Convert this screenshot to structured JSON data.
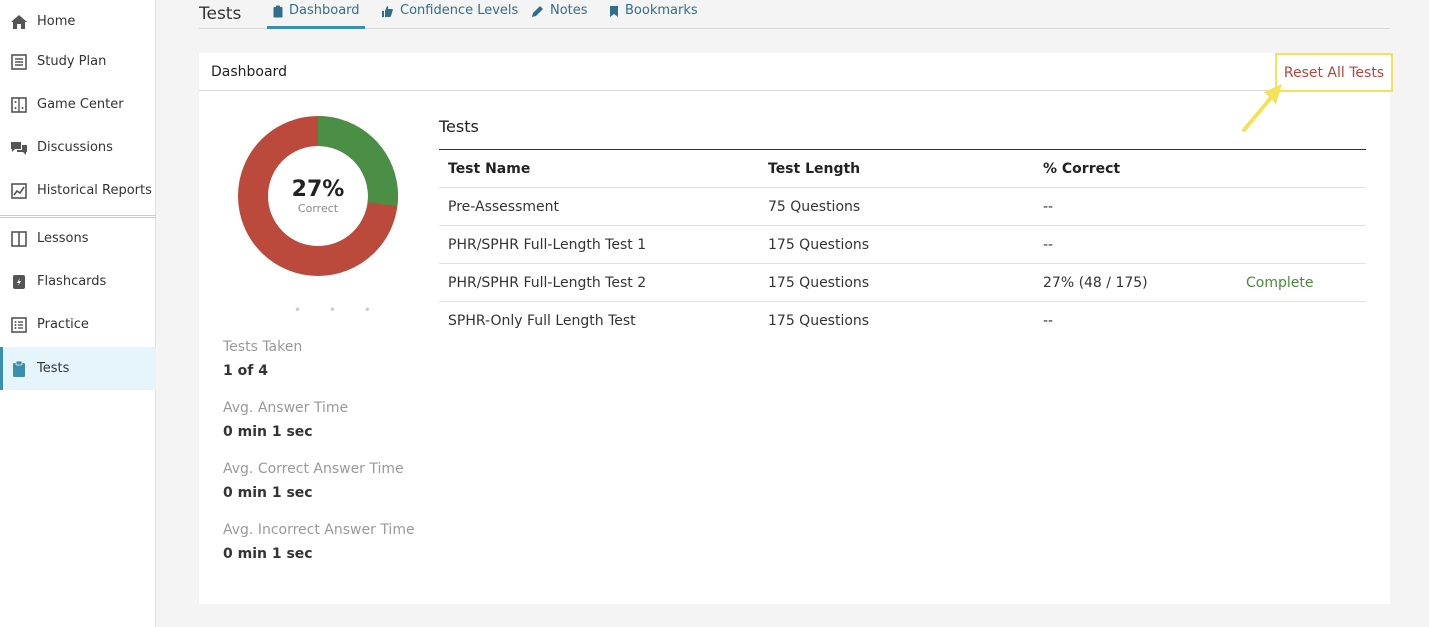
{
  "sidebar": {
    "items": [
      {
        "label": "Home",
        "icon": "home-icon"
      },
      {
        "label": "Study Plan",
        "icon": "study-plan-icon"
      },
      {
        "label": "Game Center",
        "icon": "game-center-icon"
      },
      {
        "label": "Discussions",
        "icon": "discussions-icon"
      },
      {
        "label": "Historical Reports",
        "icon": "historical-reports-icon"
      },
      {
        "label": "Lessons",
        "icon": "lessons-icon"
      },
      {
        "label": "Flashcards",
        "icon": "flashcards-icon"
      },
      {
        "label": "Practice",
        "icon": "practice-icon"
      },
      {
        "label": "Tests",
        "icon": "tests-icon"
      }
    ]
  },
  "header": {
    "title": "Tests",
    "tabs": [
      {
        "label": "Dashboard",
        "icon": "clipboard-icon"
      },
      {
        "label": "Confidence Levels",
        "icon": "thumbs-icon"
      },
      {
        "label": "Notes",
        "icon": "pencil-icon"
      },
      {
        "label": "Bookmarks",
        "icon": "bookmark-icon"
      }
    ]
  },
  "panel": {
    "title": "Dashboard",
    "reset_label": "Reset All Tests"
  },
  "summary": {
    "percent": "27%",
    "percent_label": "Correct",
    "correct_fraction": 0.27,
    "colors": {
      "correct": "#4a8f45",
      "incorrect": "#bb4a3c"
    },
    "stats": [
      {
        "label": "Tests Taken",
        "value": "1 of 4"
      },
      {
        "label": "Avg. Answer Time",
        "value": "0 min 1 sec"
      },
      {
        "label": "Avg. Correct Answer Time",
        "value": "0 min 1 sec"
      },
      {
        "label": "Avg. Incorrect Answer Time",
        "value": "0 min 1 sec"
      }
    ]
  },
  "tests": {
    "heading": "Tests",
    "columns": [
      "Test Name",
      "Test Length",
      "% Correct"
    ],
    "rows": [
      {
        "name": "Pre-Assessment",
        "length": "75 Questions",
        "correct": "--",
        "status": ""
      },
      {
        "name": "PHR/SPHR Full-Length Test 1",
        "length": "175 Questions",
        "correct": "--",
        "status": ""
      },
      {
        "name": "PHR/SPHR Full-Length Test 2",
        "length": "175 Questions",
        "correct": "27% (48 / 175)",
        "status": "Complete"
      },
      {
        "name": "SPHR-Only Full Length Test",
        "length": "175 Questions",
        "correct": "--",
        "status": ""
      }
    ]
  }
}
